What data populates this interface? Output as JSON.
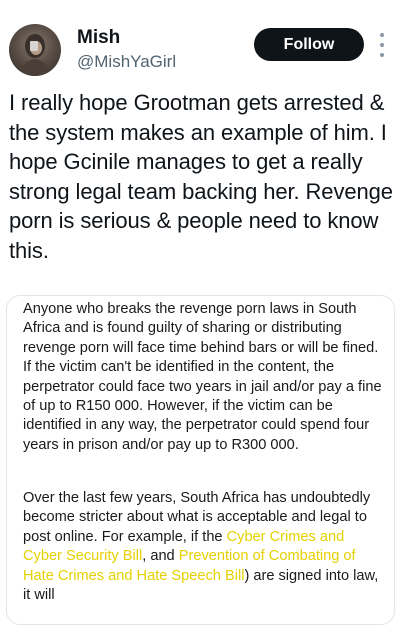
{
  "tweet": {
    "author_name": "Mish",
    "author_handle": "@MishYaGirl",
    "follow_label": "Follow",
    "text": "I really hope Grootman gets arrested & the system makes an example of him. I hope Gcinile manages to get a really strong legal team backing her. Revenge porn is serious & people need to know this."
  },
  "image_card": {
    "paragraph_1": "Anyone who breaks the revenge porn laws in South Africa and is found guilty of sharing or distributing revenge porn will face time behind bars or will be fined. If the victim can't be identified in the content, the perpetrator could face two years in jail and/or pay a fine of up to R150 000. However, if the victim can be identified in any way, the perpetrator could spend four years in prison and/or pay up to R300 000.",
    "paragraph_2_part1": "Over the last few years, South Africa has undoubtedly become stricter about what is acceptable and legal to post online. For example, if the ",
    "link_1": "Cyber Crimes and Cyber Security Bill",
    "paragraph_2_part2": ", and ",
    "link_2": "Prevention of Combating of Hate Crimes and Hate Speech Bill",
    "paragraph_2_part3": ") are signed into law, it will"
  },
  "colors": {
    "follow_button_bg": "#0f1419",
    "handle_text": "#536471",
    "link_highlight": "#e6d100"
  },
  "icons": {
    "more_menu": "more-vertical-icon"
  }
}
